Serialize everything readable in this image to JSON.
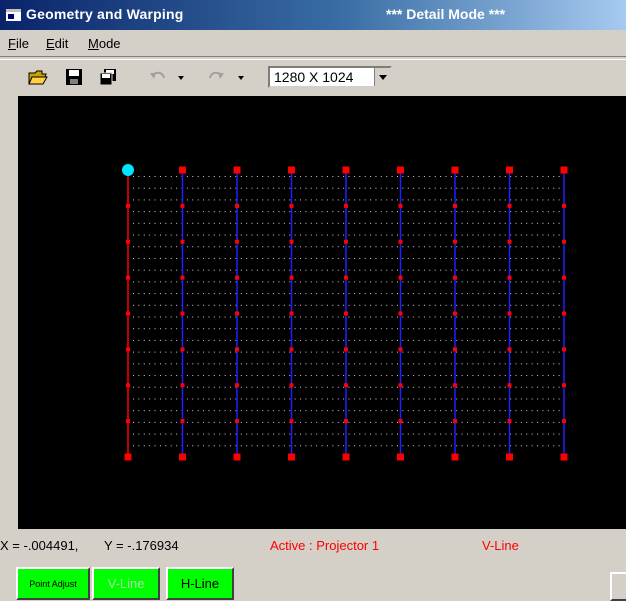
{
  "window": {
    "title": "Geometry and Warping",
    "mode_banner": "*** Detail Mode ***"
  },
  "menu": [
    {
      "accel": "F",
      "rest": "ile"
    },
    {
      "accel": "E",
      "rest": "dit"
    },
    {
      "accel": "M",
      "rest": "ode"
    }
  ],
  "toolbar": {
    "icons": [
      "open-folder-icon",
      "save-icon",
      "copy-all-icon",
      "undo-icon",
      "undo-dropdown-icon",
      "redo-icon",
      "redo-dropdown-icon"
    ],
    "resolution": "1280 X 1024"
  },
  "grid": {
    "columns": 9,
    "rows": 9,
    "dot_rows": 24,
    "dot_cols": 80,
    "active_point": {
      "column": 0,
      "row": 0
    },
    "colors": {
      "background": "#000000",
      "control_point": "#ff0000",
      "active_point": "#00e5ff",
      "v_line": "#2020ff",
      "active_line": "#ff0000",
      "dot": "#d0d0d0"
    }
  },
  "status": {
    "x_text": "X = -.004491,",
    "y_text": "Y = -.176934",
    "active_text": "Active : Projector 1",
    "mode_text": "V-Line",
    "status_color": "#ff0000"
  },
  "buttons": {
    "point_adjust": "Point Adjust",
    "v_line": "V-Line",
    "h_line": "H-Line",
    "color": "#00ff00"
  }
}
